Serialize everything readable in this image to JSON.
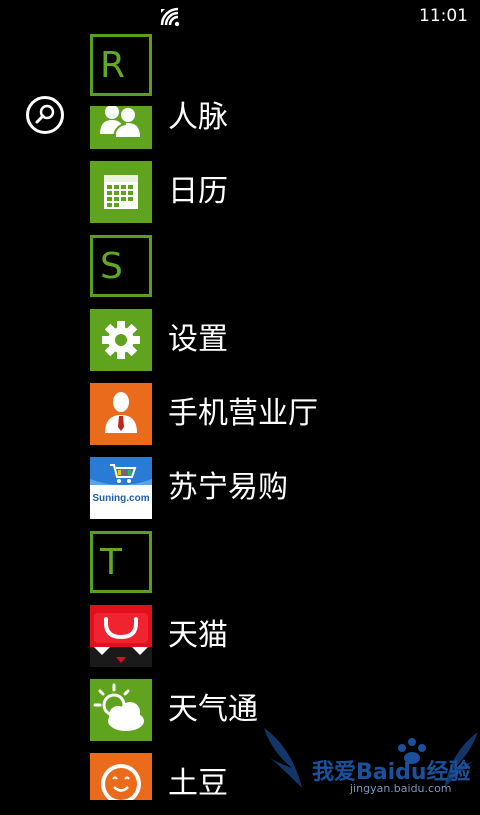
{
  "status": {
    "time": "11:01",
    "icons": [
      "wifi-icon"
    ]
  },
  "search": {
    "icon": "search-icon"
  },
  "list": [
    {
      "kind": "header",
      "letter": "R"
    },
    {
      "kind": "app",
      "label": "人脉",
      "icon": "people-icon",
      "color": "#5fa31f"
    },
    {
      "kind": "app",
      "label": "日历",
      "icon": "calendar-icon",
      "color": "#5fa31f"
    },
    {
      "kind": "header",
      "letter": "S"
    },
    {
      "kind": "app",
      "label": "设置",
      "icon": "gear-icon",
      "color": "#5fa31f"
    },
    {
      "kind": "app",
      "label": "手机营业厅",
      "icon": "business-hall-icon",
      "color": "#ea6b1b"
    },
    {
      "kind": "app",
      "label": "苏宁易购",
      "icon": "suning-icon",
      "logo_text": "Suning.com",
      "color": "#2a7bd4"
    },
    {
      "kind": "header",
      "letter": "T"
    },
    {
      "kind": "app",
      "label": "天猫",
      "icon": "tmall-icon",
      "color": "#d90f1c"
    },
    {
      "kind": "app",
      "label": "天气通",
      "icon": "weather-icon",
      "color": "#5fa31f"
    },
    {
      "kind": "app",
      "label": "土豆",
      "icon": "tudou-icon",
      "color": "#ea6b1b"
    }
  ],
  "watermark": {
    "text": "我爱Baidu经验",
    "url": "jingyan.baidu.com"
  },
  "colors": {
    "accent": "#5fa31f",
    "orange": "#ea6b1b",
    "background": "#000000"
  }
}
